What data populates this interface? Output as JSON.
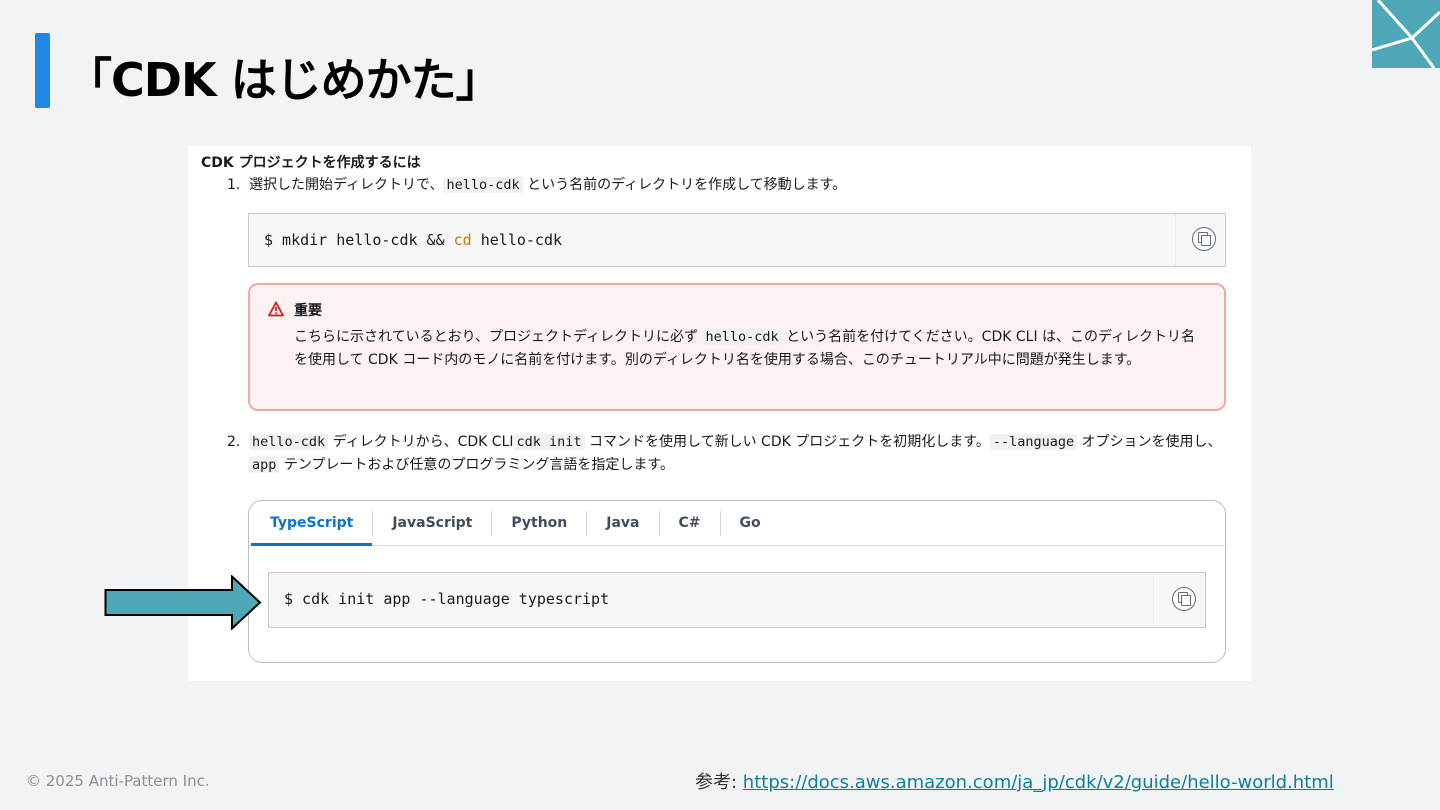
{
  "slide": {
    "title": "「CDK はじめかた」",
    "footer_copyright": "© 2025 Anti-Pattern Inc.",
    "reference_label": "参考: ",
    "reference_url": "https://docs.aws.amazon.com/ja_jp/cdk/v2/guide/hello-world.html"
  },
  "doc": {
    "heading": "CDK プロジェクトを作成するには",
    "step1": {
      "num": "1.",
      "text_before": "選択した開始ディレクトリで、",
      "code": "hello-cdk",
      "text_after": " という名前のディレクトリを作成して移動します。"
    },
    "code1": {
      "prefix": "$ mkdir hello-cdk && ",
      "keyword": "cd",
      "suffix": " hello-cdk"
    },
    "alert": {
      "title": "重要",
      "line_before": "こちらに示されているとおり、プロジェクトディレクトリに必ず ",
      "code": "hello-cdk",
      "line_after": " という名前を付けてください。CDK CLI は、このディレクトリ名を使用して CDK コード内のモノに名前を付けます。別のディレクトリ名を使用する場合、このチュートリアル中に問題が発生します。"
    },
    "step2": {
      "num": "2.",
      "code_a": "hello-cdk",
      "text_a": " ディレクトリから、CDK CLI",
      "code_b": "cdk init",
      "text_b": " コマンドを使用して新しい CDK プロジェクトを初期化します。",
      "code_c": "--language",
      "text_c": " オプションを使用し、",
      "code_d": "app",
      "text_d": " テンプレートおよび任意のプログラミング言語を指定します。"
    },
    "tabs": [
      "TypeScript",
      "JavaScript",
      "Python",
      "Java",
      "C#",
      "Go"
    ],
    "active_tab": "TypeScript",
    "code2": "$ cdk init app --language typescript"
  },
  "colors": {
    "accent_bar": "#1f88e5",
    "arrow": "#4fa8b8",
    "tab_active": "#0972d3",
    "alert_border": "#eda9a4"
  }
}
